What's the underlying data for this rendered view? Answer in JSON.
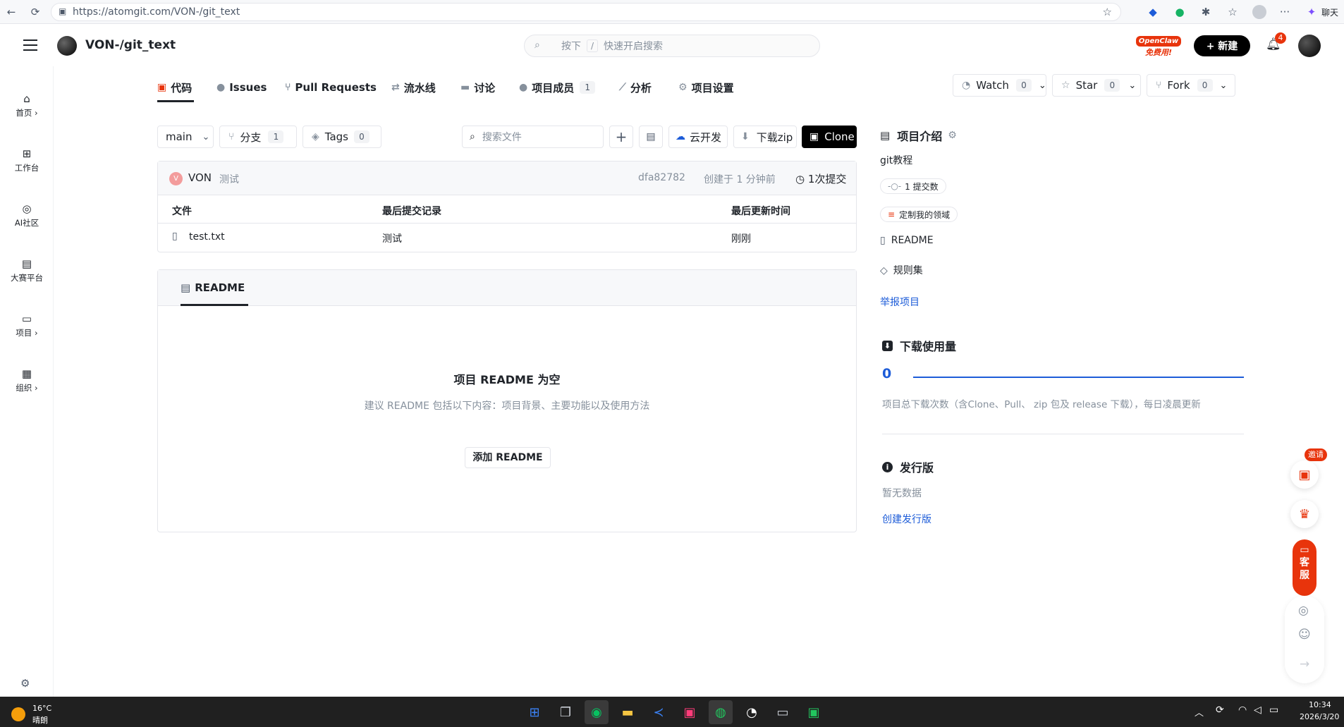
{
  "browser": {
    "url": "https://atomgit.com/VON-/git_text",
    "chat_label": "聊天"
  },
  "header": {
    "repo_title": "VON-/git_text",
    "search_placeholder_prefix": "按下",
    "search_key": "/",
    "search_placeholder_suffix": "快速开启搜索",
    "promo_line1": "OpenClaw",
    "promo_line2": "免费用!",
    "new_label": "+ 新建",
    "notification_count": "4"
  },
  "sidebar": {
    "items": [
      {
        "label": "首页",
        "icon": "home-icon"
      },
      {
        "label": "工作台",
        "icon": "workbench-icon"
      },
      {
        "label": "AI社区",
        "icon": "ai-community-icon"
      },
      {
        "label": "大赛平台",
        "icon": "contest-icon"
      },
      {
        "label": "项目",
        "icon": "folder-icon"
      },
      {
        "label": "组织",
        "icon": "organization-icon"
      }
    ]
  },
  "tabs": [
    {
      "label": "代码",
      "icon": "code-icon",
      "active": true
    },
    {
      "label": "Issues",
      "icon": "issue-icon"
    },
    {
      "label": "Pull Requests",
      "icon": "pull-request-icon"
    },
    {
      "label": "流水线",
      "icon": "pipeline-icon"
    },
    {
      "label": "讨论",
      "icon": "discussion-icon"
    },
    {
      "label": "项目成员",
      "icon": "members-icon",
      "badge": "1"
    },
    {
      "label": "分析",
      "icon": "analysis-icon"
    },
    {
      "label": "项目设置",
      "icon": "settings-icon"
    }
  ],
  "repo_actions": {
    "watch": {
      "label": "Watch",
      "count": "0"
    },
    "star": {
      "label": "Star",
      "count": "0"
    },
    "fork": {
      "label": "Fork",
      "count": "0"
    }
  },
  "toolbar": {
    "branch": "main",
    "branches_label": "分支",
    "branches_count": "1",
    "tags_label": "Tags",
    "tags_count": "0",
    "search_file_placeholder": "搜索文件",
    "add_icon": "+",
    "cloud_dev_label": "云开发",
    "download_zip_label": "下载zip",
    "clone_label": "Clone"
  },
  "commit_bar": {
    "avatar_letter": "V",
    "author": "VON",
    "message": "测试",
    "hash": "dfa82782",
    "time": "创建于 1 分钟前",
    "commits": "1次提交"
  },
  "file_table": {
    "headers": [
      "文件",
      "最后提交记录",
      "最后更新时间"
    ],
    "rows": [
      {
        "name": "test.txt",
        "commit": "测试",
        "time": "刚刚"
      }
    ]
  },
  "readme": {
    "tab_label": "README",
    "empty_title": "项目 README 为空",
    "empty_hint": "建议 README 包括以下内容：项目背景、主要功能以及使用方法",
    "add_button": "添加 README"
  },
  "right_panel": {
    "intro_title": "项目介绍",
    "description": "git教程",
    "commits_pill": "1 提交数",
    "domain_pill": "定制我的领域",
    "readme_link": "README",
    "rules_link": "规则集",
    "report_link": "举报项目",
    "downloads_title": "下载使用量",
    "downloads_value": "0",
    "downloads_note": "项目总下载次数（含Clone、Pull、 zip 包及 release 下载），每日凌晨更新",
    "release_title": "发行版",
    "release_empty": "暂无数据",
    "release_create": "创建发行版"
  },
  "floating": {
    "invite_label": "邀请",
    "service_label": "客服"
  },
  "taskbar": {
    "temperature": "16°C",
    "weather": "晴朗",
    "time": "10:34",
    "date": "2026/3/20"
  },
  "colors": {
    "accent": "#1d5cd8",
    "danger": "#e8340c",
    "dark": "#000000"
  }
}
